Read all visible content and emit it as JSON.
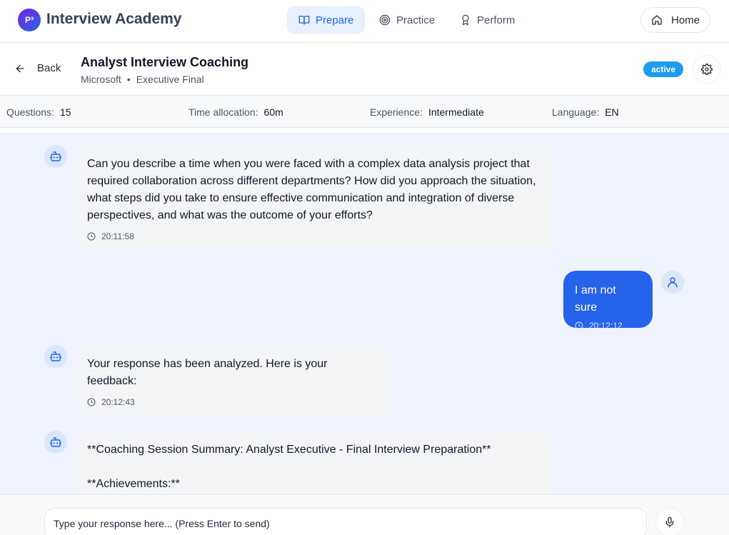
{
  "app": {
    "logo_text": "P³",
    "title": "Interview Academy"
  },
  "nav": {
    "tabs": [
      {
        "label": "Prepare",
        "icon": "book-open-icon",
        "active": true
      },
      {
        "label": "Practice",
        "icon": "target-icon",
        "active": false
      },
      {
        "label": "Perform",
        "icon": "award-icon",
        "active": false
      }
    ],
    "home_label": "Home"
  },
  "session": {
    "back_label": "Back",
    "title": "Analyst Interview Coaching",
    "company": "Microsoft",
    "separator": "•",
    "round": "Executive Final",
    "status": "active"
  },
  "stats": {
    "questions": {
      "label": "Questions:",
      "value": "15"
    },
    "time": {
      "label": "Time allocation:",
      "value": "60m"
    },
    "experience": {
      "label": "Experience:",
      "value": "Intermediate"
    },
    "language": {
      "label": "Language:",
      "value": "EN"
    }
  },
  "messages": [
    {
      "role": "bot",
      "text": "Can you describe a time when you were faced with a complex data analysis project that required collaboration across different departments? How did you approach the situation, what steps did you take to ensure effective communication and integration of diverse perspectives, and what was the outcome of your efforts?",
      "time": "20:11:58"
    },
    {
      "role": "user",
      "text": "I am not sure",
      "time": "20:12:12"
    },
    {
      "role": "bot",
      "text": "Your response has been analyzed. Here is your feedback:",
      "time": "20:12:43"
    },
    {
      "role": "bot",
      "text": "**Coaching Session Summary: Analyst Executive - Final Interview Preparation**",
      "text2": "**Achievements:**"
    }
  ],
  "composer": {
    "placeholder": "Type your response here... (Press Enter to send)"
  },
  "colors": {
    "accent": "#2563eb",
    "status_badge": "#1d9bf0",
    "chat_bg": "#eef3fd",
    "bot_bubble": "#f3f4f6"
  }
}
